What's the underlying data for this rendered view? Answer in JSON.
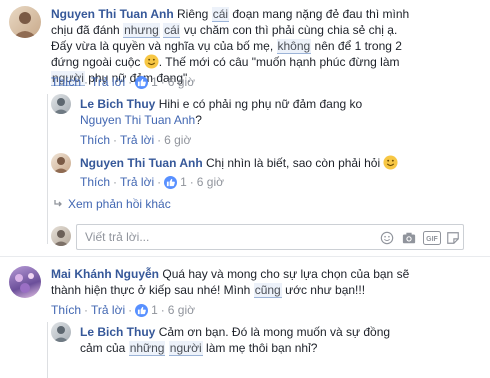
{
  "labels": {
    "like": "Thích",
    "reply": "Trả lời"
  },
  "comments": [
    {
      "author": "Nguyen Thi Tuan Anh",
      "text": {
        "p1": "Riêng ",
        "h1": "cái",
        "p2": " đoạn mang nặng đẻ đau thì mình chịu đã đánh ",
        "h2": "nhưng",
        "p3": " ",
        "h3": "cái",
        "p4": " vụ chăm con thì phải cùng chia sẻ chị ạ. Đấy vừa là quyền và nghĩa vụ của bố mẹ, ",
        "h4": "không",
        "p5": " nên để 1 trong 2 đứng ngoài cuộc",
        "p6": ". Thế mới có câu \"muốn hạnh phúc đừng làm ",
        "h5": "người",
        "p7": " phụ nữ đảm đang\"."
      },
      "like_count": "1",
      "time": "6 giờ"
    },
    {
      "author": "Le Bich Thuy",
      "text_before": "Hihi e có phải ng phụ nữ đảm đang ko ",
      "mention": "Nguyen Thi Tuan Anh",
      "text_after": "?",
      "time": "6 giờ"
    },
    {
      "author": "Nguyen Thi Tuan Anh",
      "text": "Chị nhìn là biết, sao còn phải hỏi",
      "like_count": "1",
      "time": "6 giờ"
    },
    {
      "author": "Mai Khánh Nguyễn",
      "text": {
        "p1": "Quá hay và mong cho sự lựa chọn của bạn sẽ thành hiện thực ở kiếp sau nhé! Mình ",
        "h1": "cũng",
        "p2": " ước như bạn!!!"
      },
      "like_count": "1",
      "time": "6 giờ"
    },
    {
      "author": "Le Bich Thuy",
      "text": {
        "p1": "Cảm ơn bạn. Đó là mong muốn và sự đồng cảm của ",
        "h1": "những",
        "p2": " ",
        "h2": "người",
        "p3": " làm mẹ thôi bạn nhỉ?"
      }
    }
  ],
  "more_replies": "Xem phản hồi khác",
  "reply_input": {
    "placeholder": "Viết trả lời..."
  },
  "icons": [
    "like-icon",
    "smile-emoji-icon",
    "reply-arrow-icon",
    "emoji-icon",
    "camera-icon",
    "gif-icon",
    "sticker-icon"
  ],
  "colors": {
    "link": "#4267b2",
    "author": "#365899",
    "meta": "#90949c",
    "like_badge": "#5890ff"
  }
}
